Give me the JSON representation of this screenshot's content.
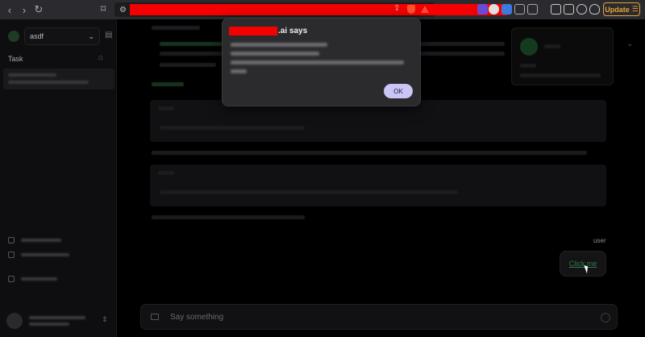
{
  "browser": {
    "update_label": "Update",
    "url_redacted": true
  },
  "sidebar": {
    "workspace": "asdf",
    "section_label": "Task"
  },
  "chat": {
    "user_label": "user",
    "user_message": "Click me",
    "composer_placeholder": "Say something"
  },
  "dialog": {
    "title_suffix": ".ai says",
    "ok_label": "OK"
  },
  "colors": {
    "accent_green": "#2e7d4a",
    "update_orange": "#e8a13a",
    "redaction": "#f50000",
    "ok_button": "#c9c5f5"
  }
}
